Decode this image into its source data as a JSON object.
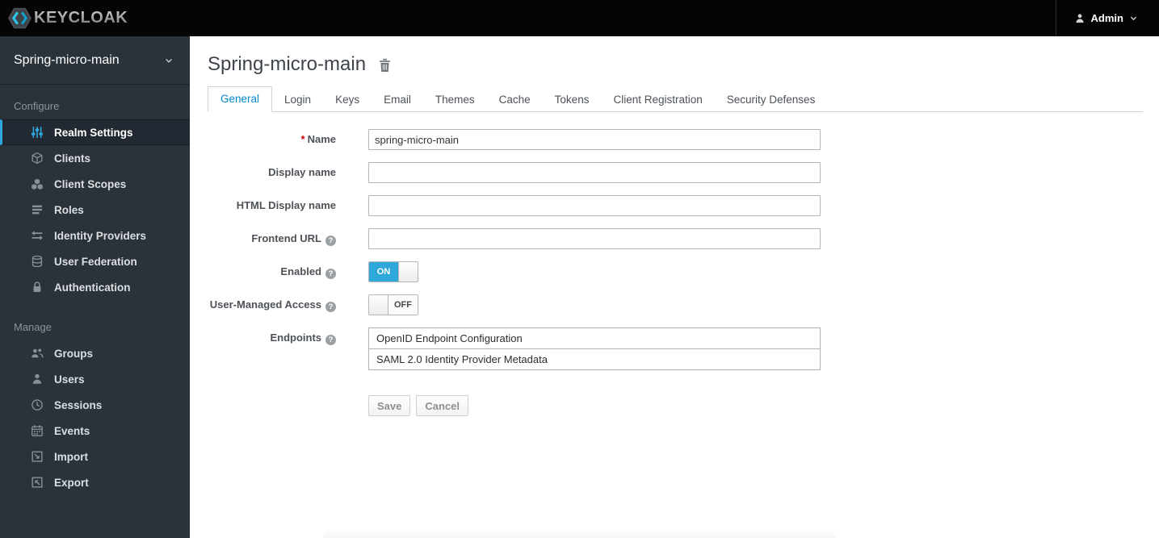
{
  "colors": {
    "accent": "#0088ce",
    "toggle_on": "#2ea7d9",
    "topbar_bg": "#050505",
    "sidebar_bg": "#2b333a",
    "active_indicator": "#2fa8dd"
  },
  "topbar": {
    "brand": "KEYCLOAK",
    "user": {
      "label": "Admin",
      "icon": "user-icon",
      "chevron": "chevron-down-icon"
    }
  },
  "sidebar": {
    "realm_selector": {
      "label": "Spring-micro-main",
      "chevron": "chevron-down-icon"
    },
    "sections": [
      {
        "label": "Configure",
        "items": [
          {
            "label": "Realm Settings",
            "icon": "sliders-icon",
            "active": true
          },
          {
            "label": "Clients",
            "icon": "cube-icon",
            "active": false
          },
          {
            "label": "Client Scopes",
            "icon": "cubes-icon",
            "active": false
          },
          {
            "label": "Roles",
            "icon": "list-icon",
            "active": false
          },
          {
            "label": "Identity Providers",
            "icon": "exchange-arrows-icon",
            "active": false
          },
          {
            "label": "User Federation",
            "icon": "database-icon",
            "active": false
          },
          {
            "label": "Authentication",
            "icon": "lock-icon",
            "active": false
          }
        ]
      },
      {
        "label": "Manage",
        "items": [
          {
            "label": "Groups",
            "icon": "group-icon",
            "active": false
          },
          {
            "label": "Users",
            "icon": "user-icon",
            "active": false
          },
          {
            "label": "Sessions",
            "icon": "clock-icon",
            "active": false
          },
          {
            "label": "Events",
            "icon": "calendar-icon",
            "active": false
          },
          {
            "label": "Import",
            "icon": "import-box-icon",
            "active": false
          },
          {
            "label": "Export",
            "icon": "export-box-icon",
            "active": false
          }
        ]
      }
    ]
  },
  "main": {
    "title": "Spring-micro-main",
    "title_action_icon": "trash-icon",
    "tabs": [
      {
        "label": "General",
        "active": true
      },
      {
        "label": "Login",
        "active": false
      },
      {
        "label": "Keys",
        "active": false
      },
      {
        "label": "Email",
        "active": false
      },
      {
        "label": "Themes",
        "active": false
      },
      {
        "label": "Cache",
        "active": false
      },
      {
        "label": "Tokens",
        "active": false
      },
      {
        "label": "Client Registration",
        "active": false
      },
      {
        "label": "Security Defenses",
        "active": false
      }
    ],
    "form": {
      "help_symbol": "?",
      "fields": [
        {
          "label": "Name",
          "required_marker": "*",
          "type": "text",
          "value": "spring-micro-main"
        },
        {
          "label": "Display name",
          "type": "text",
          "value": ""
        },
        {
          "label": "HTML Display name",
          "type": "text",
          "value": ""
        },
        {
          "label": "Frontend URL",
          "type": "text",
          "value": "",
          "help": true
        },
        {
          "label": "Enabled",
          "type": "toggle",
          "state": "ON",
          "on_label": "ON",
          "help": true
        },
        {
          "label": "User-Managed Access",
          "type": "toggle",
          "state": "OFF",
          "off_label": "OFF",
          "help": true
        },
        {
          "label": "Endpoints",
          "type": "links",
          "help": true,
          "links": [
            "OpenID Endpoint Configuration",
            "SAML 2.0 Identity Provider Metadata"
          ]
        }
      ],
      "actions": {
        "save": "Save",
        "cancel": "Cancel"
      }
    }
  }
}
